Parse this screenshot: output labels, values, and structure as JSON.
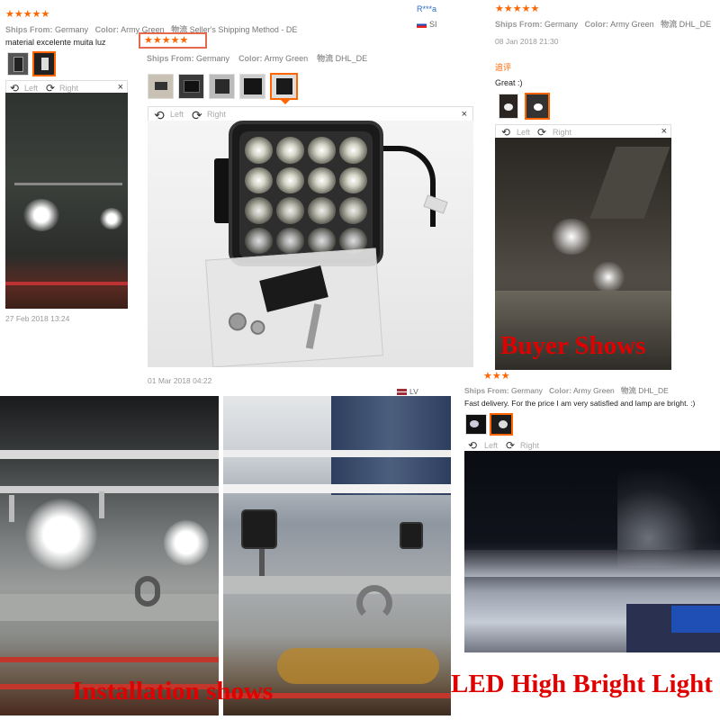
{
  "review_left": {
    "stars": "★★★★★",
    "ships_from_label": "Ships From:",
    "ships_from_value": "Germany",
    "color_label": "Color:",
    "color_value": "Army Green",
    "shipping_label": "物流",
    "shipping_value": "Seller's Shipping Method - DE",
    "text": "material excelente muita luz",
    "date": "27 Feb 2018 13:24"
  },
  "review_middle": {
    "reviewer": "R***a",
    "country": "SI",
    "stars": "★★★★★",
    "ships_from_label": "Ships From:",
    "ships_from_value": "Germany",
    "color_label": "Color:",
    "color_value": "Army Green",
    "shipping_label": "物流",
    "shipping_value": "DHL_DE",
    "date": "01 Mar 2018 04:22"
  },
  "review_right": {
    "stars": "★★★★★",
    "ships_from_label": "Ships From:",
    "ships_from_value": "Germany",
    "color_label": "Color:",
    "color_value": "Army Green",
    "shipping_label": "物流",
    "shipping_value": "DHL_DE",
    "date": "08 Jan 2018 21:30",
    "tag": "追评",
    "text": "Great :)"
  },
  "review_bottom": {
    "country": "LV",
    "stars": "★★★",
    "ships_from_label": "Ships From:",
    "ships_from_value": "Germany",
    "color_label": "Color:",
    "color_value": "Army Green",
    "shipping_label": "物流",
    "shipping_value": "DHL_DE",
    "text": "Fast delivery. For the price I am very satisfied and lamp are bright. :)"
  },
  "viewer": {
    "left_label": "Left",
    "right_label": "Right",
    "close": "×"
  },
  "captions": {
    "buyer": "Buyer Shows",
    "installation": "Installation shows",
    "led": "LED High Bright Light"
  },
  "colors": {
    "star": "#ff6600",
    "caption_red": "#e00000",
    "selected_border": "#ff6600"
  }
}
